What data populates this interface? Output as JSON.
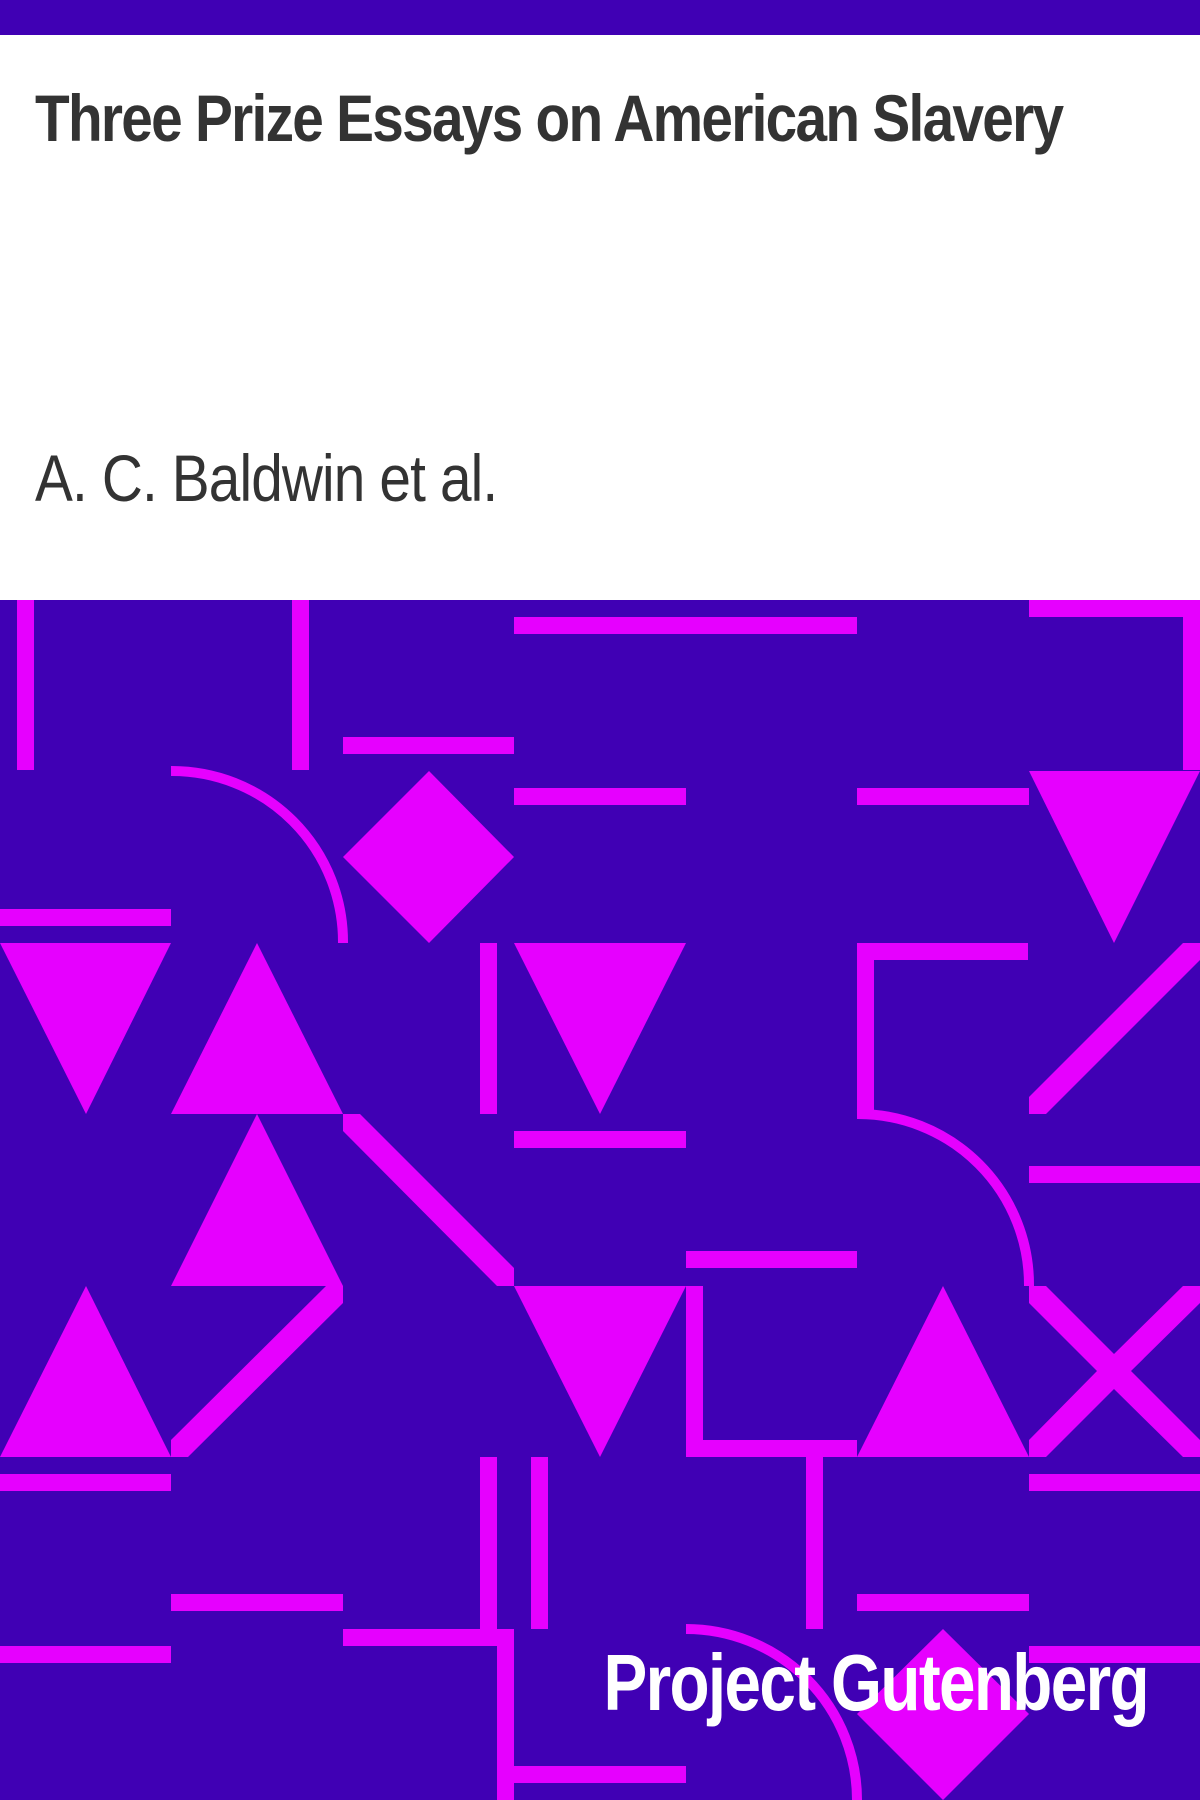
{
  "cover": {
    "title": "Three Prize Essays on American Slavery",
    "author": "A. C. Baldwin et al.",
    "brand": "Project Gutenberg"
  },
  "colors": {
    "background": "#4000b4",
    "pattern": "#e600ff",
    "text_dark": "#333333",
    "text_light": "#ffffff",
    "header_bg": "#ffffff"
  }
}
